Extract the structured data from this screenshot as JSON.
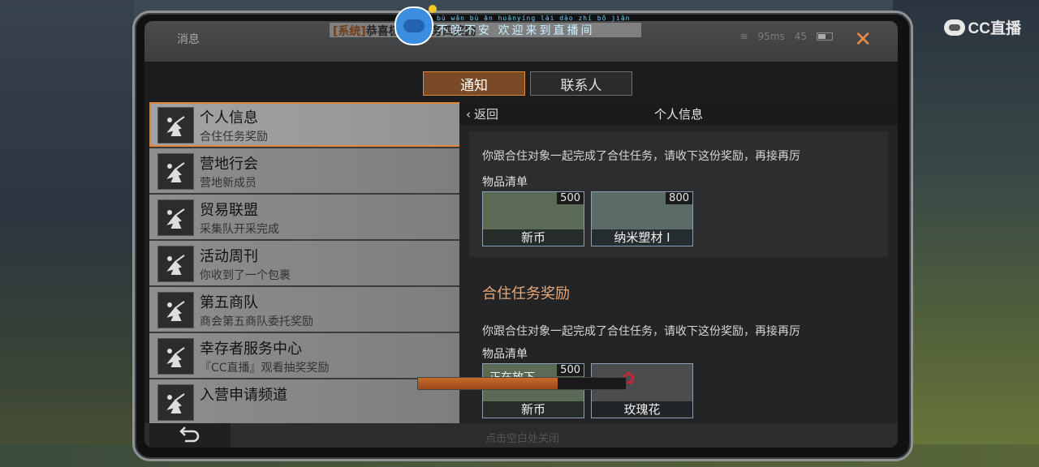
{
  "watermark": {
    "brand": "CC直播"
  },
  "window": {
    "title": "消息"
  },
  "marquee": {
    "tag": "[系统]",
    "text": "恭喜极 … 任务四奖励"
  },
  "danmu": {
    "pinyin": "bù wǎn bù ān huānyíng lái dào zhí bō jiān",
    "text": "不晚不安 欢迎来到直播间"
  },
  "status": {
    "ping": "95ms",
    "fps": "45"
  },
  "tabs": [
    {
      "label": "通知",
      "active": true
    },
    {
      "label": "联系人",
      "active": false
    }
  ],
  "messages": [
    {
      "title": "个人信息",
      "subtitle": "合住任务奖励"
    },
    {
      "title": "营地行会",
      "subtitle": "营地新成员"
    },
    {
      "title": "贸易联盟",
      "subtitle": "采集队开采完成"
    },
    {
      "title": "活动周刊",
      "subtitle": "你收到了一个包裹"
    },
    {
      "title": "第五商队",
      "subtitle": "商会第五商队委托奖励"
    },
    {
      "title": "幸存者服务中心",
      "subtitle": "『CC直播』观看抽奖奖励"
    },
    {
      "title": "入营申请频道",
      "subtitle": ""
    }
  ],
  "detail": {
    "back_label": "返回",
    "title": "个人信息",
    "block1": {
      "desc": "你跟合住对象一起完成了合住任务，请收下这份奖励，再接再厉",
      "list_label": "物品清单",
      "rewards": [
        {
          "name": "新币",
          "qty": "500"
        },
        {
          "name": "纳米塑材 I",
          "qty": "800"
        }
      ]
    },
    "block2": {
      "section_title": "合住任务奖励",
      "desc": "你跟合住对象一起完成了合住任务，请收下这份奖励，再接再厉",
      "list_label": "物品清单",
      "rewards": [
        {
          "name": "新币",
          "qty": "500"
        },
        {
          "name": "玫瑰花",
          "qty": ""
        }
      ]
    },
    "placing_label": "正在放下…",
    "placing_progress": 0.67
  },
  "footer": {
    "claim_hint": "点击空白处关闭"
  },
  "colors": {
    "accent": "#e0883a",
    "section_title": "#e8a878"
  }
}
